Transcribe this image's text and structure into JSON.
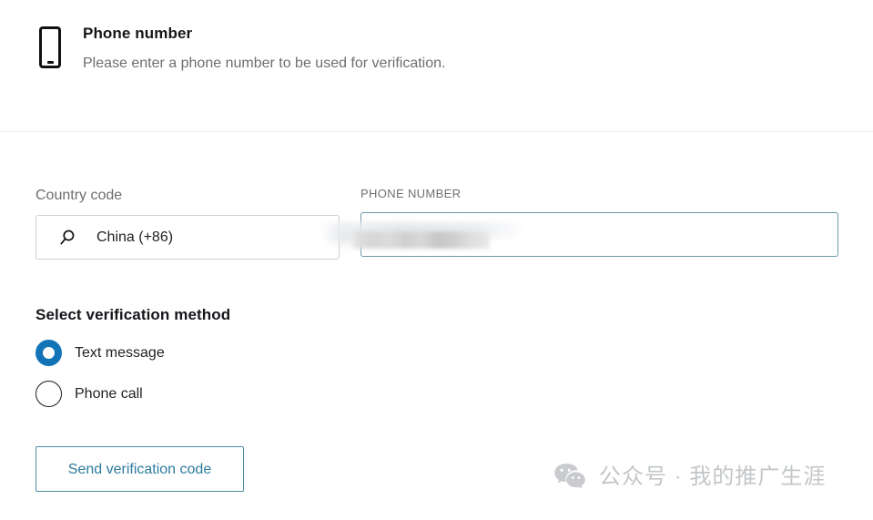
{
  "header": {
    "icon": "mobile-phone-icon",
    "title": "Phone number",
    "subtitle": "Please enter a phone number to be used for verification."
  },
  "form": {
    "country": {
      "label": "Country code",
      "icon": "search-icon",
      "value": "China (+86)",
      "placeholder": "Country code"
    },
    "phone": {
      "label": "PHONE NUMBER",
      "value": "",
      "placeholder": "Phone number",
      "redacted": true,
      "focused": true
    }
  },
  "verification": {
    "title": "Select verification method",
    "options": [
      {
        "label": "Text message",
        "selected": true
      },
      {
        "label": "Phone call",
        "selected": false
      }
    ]
  },
  "actions": {
    "send_label": "Send verification code"
  },
  "watermark": {
    "icon": "wechat-icon",
    "text": "公众号 · 我的推广生涯"
  },
  "colors": {
    "accent_blue": "#1274b7",
    "field_focus_border": "#6b98a6",
    "button_border": "#4d8ba3",
    "button_text": "#2d7b9e",
    "label_gray": "#6e6e6e",
    "watermark_gray": "#c3c6c9"
  }
}
